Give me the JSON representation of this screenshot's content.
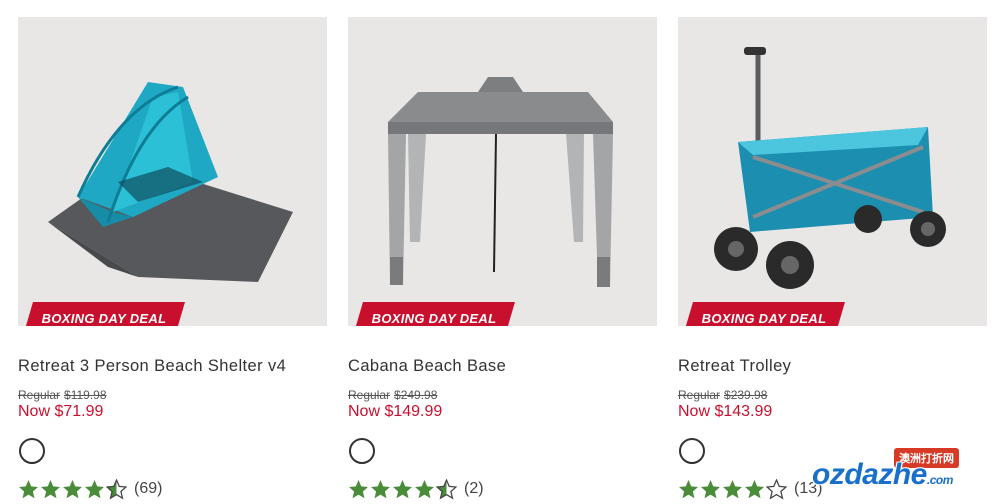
{
  "products": [
    {
      "badge": "BOXING DAY DEAL",
      "title": "Retreat 3 Person Beach Shelter v4",
      "regular_label": "Regular",
      "regular_price": "$119.98",
      "now_price": "Now $71.99",
      "rating": 4.5,
      "review_count": "(69)",
      "image_icon": "beach-shelter-image"
    },
    {
      "badge": "BOXING DAY DEAL",
      "title": "Cabana Beach Base",
      "regular_label": "Regular",
      "regular_price": "$249.98",
      "now_price": "Now $149.99",
      "rating": 4.5,
      "review_count": "(2)",
      "image_icon": "cabana-image"
    },
    {
      "badge": "BOXING DAY DEAL",
      "title": "Retreat Trolley",
      "regular_label": "Regular",
      "regular_price": "$239.98",
      "now_price": "Now $143.99",
      "rating": 4,
      "review_count": "(13)",
      "image_icon": "trolley-image"
    }
  ],
  "watermark": {
    "tag": "澳洲打折网",
    "text": "ozdazhe",
    "suffix": ".com"
  },
  "colors": {
    "sale_red": "#c8102e",
    "star_green": "#4a8c3a",
    "image_bg": "#e9e7e5"
  }
}
